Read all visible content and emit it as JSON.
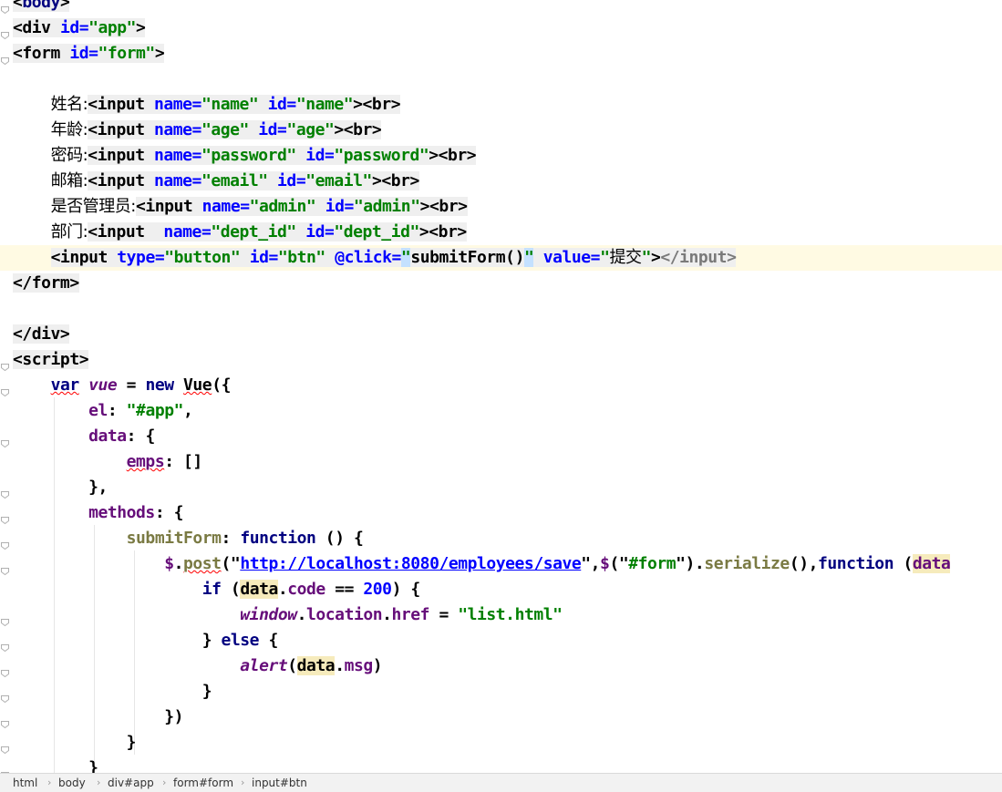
{
  "editor": {
    "lines": [
      {
        "segs": [
          [
            "<",
            "tag"
          ],
          [
            "body",
            "tag tn"
          ],
          [
            ">",
            "tag"
          ]
        ]
      },
      {
        "segs": [
          [
            "<div ",
            "tag"
          ],
          [
            "id=",
            "tag an"
          ],
          [
            "\"app\"",
            "tag av"
          ],
          [
            ">",
            "tag"
          ]
        ]
      },
      {
        "segs": [
          [
            "<form ",
            "tag"
          ],
          [
            "id=",
            "tag an"
          ],
          [
            "\"form\"",
            "tag av"
          ],
          [
            ">",
            "tag"
          ]
        ]
      },
      {
        "segs": []
      },
      {
        "segs": [
          [
            "    ",
            ""
          ],
          [
            "姓名:",
            "cjk"
          ],
          [
            "<input ",
            "tag"
          ],
          [
            "name=",
            "tag an"
          ],
          [
            "\"name\" ",
            "tag av"
          ],
          [
            "id=",
            "tag an"
          ],
          [
            "\"name\"",
            "tag av"
          ],
          [
            "><br>",
            "tag"
          ]
        ]
      },
      {
        "segs": [
          [
            "    ",
            ""
          ],
          [
            "年龄:",
            "cjk"
          ],
          [
            "<input ",
            "tag"
          ],
          [
            "name=",
            "tag an"
          ],
          [
            "\"age\" ",
            "tag av"
          ],
          [
            "id=",
            "tag an"
          ],
          [
            "\"age\"",
            "tag av"
          ],
          [
            "><br>",
            "tag"
          ]
        ]
      },
      {
        "segs": [
          [
            "    ",
            ""
          ],
          [
            "密码:",
            "cjk"
          ],
          [
            "<input ",
            "tag"
          ],
          [
            "name=",
            "tag an"
          ],
          [
            "\"password\" ",
            "tag av"
          ],
          [
            "id=",
            "tag an"
          ],
          [
            "\"password\"",
            "tag av"
          ],
          [
            "><br>",
            "tag"
          ]
        ]
      },
      {
        "segs": [
          [
            "    ",
            ""
          ],
          [
            "邮箱:",
            "cjk"
          ],
          [
            "<input ",
            "tag"
          ],
          [
            "name=",
            "tag an"
          ],
          [
            "\"email\" ",
            "tag av"
          ],
          [
            "id=",
            "tag an"
          ],
          [
            "\"email\"",
            "tag av"
          ],
          [
            "><br>",
            "tag"
          ]
        ]
      },
      {
        "segs": [
          [
            "    ",
            ""
          ],
          [
            "是否管理员:",
            "cjk"
          ],
          [
            "<input ",
            "tag"
          ],
          [
            "name=",
            "tag an"
          ],
          [
            "\"admin\" ",
            "tag av"
          ],
          [
            "id=",
            "tag an"
          ],
          [
            "\"admin\"",
            "tag av"
          ],
          [
            "><br>",
            "tag"
          ]
        ]
      },
      {
        "segs": [
          [
            "    ",
            ""
          ],
          [
            "部门:",
            "cjk"
          ],
          [
            "<input  ",
            "tag"
          ],
          [
            "name=",
            "tag an"
          ],
          [
            "\"dept_id\" ",
            "tag av"
          ],
          [
            "id=",
            "tag an"
          ],
          [
            "\"dept_id\"",
            "tag av"
          ],
          [
            "><br>",
            "tag"
          ]
        ]
      },
      {
        "cur": true,
        "segs": [
          [
            "    ",
            ""
          ],
          [
            "<input ",
            "tag"
          ],
          [
            "type=",
            "tag an"
          ],
          [
            "\"button\" ",
            "tag av"
          ],
          [
            "id=",
            "tag an"
          ],
          [
            "\"btn\" ",
            "tag av"
          ],
          [
            "@click=",
            "tag an"
          ],
          [
            "\"",
            "tag av sel"
          ],
          [
            "submitForm()",
            "tag"
          ],
          [
            "\"",
            "tag av sel"
          ],
          [
            " value=",
            "tag an"
          ],
          [
            "\"",
            "tag av"
          ],
          [
            "提交",
            "tag cjk"
          ],
          [
            "\"",
            "tag av"
          ],
          [
            ">",
            "tag"
          ],
          [
            "</input>",
            "tag closeh"
          ]
        ]
      },
      {
        "segs": [
          [
            "</form>",
            "tag"
          ]
        ]
      },
      {
        "segs": []
      },
      {
        "segs": [
          [
            "</div>",
            "tag"
          ]
        ]
      },
      {
        "segs": [
          [
            "<script>",
            "tag"
          ]
        ]
      },
      {
        "segs": [
          [
            "    ",
            ""
          ],
          [
            "var",
            "kw squig"
          ],
          [
            " ",
            ""
          ],
          [
            "vue",
            "var"
          ],
          [
            " = ",
            ""
          ],
          [
            "new ",
            "kw"
          ],
          [
            "Vue",
            "squig"
          ],
          [
            "({",
            ""
          ]
        ]
      },
      {
        "segs": [
          [
            "        ",
            ""
          ],
          [
            "el",
            "prop"
          ],
          [
            ": ",
            ""
          ],
          [
            "\"#app\"",
            "str"
          ],
          [
            ",",
            ""
          ]
        ]
      },
      {
        "segs": [
          [
            "        ",
            ""
          ],
          [
            "data",
            "prop"
          ],
          [
            ": {",
            ""
          ]
        ]
      },
      {
        "segs": [
          [
            "            ",
            ""
          ],
          [
            "emps",
            "prop squig"
          ],
          [
            ": []",
            ""
          ]
        ]
      },
      {
        "segs": [
          [
            "        },",
            ""
          ]
        ]
      },
      {
        "segs": [
          [
            "        ",
            ""
          ],
          [
            "methods",
            "prop"
          ],
          [
            ": {",
            ""
          ]
        ]
      },
      {
        "segs": [
          [
            "            ",
            ""
          ],
          [
            "submitForm",
            "mc"
          ],
          [
            ": ",
            ""
          ],
          [
            "function",
            "kw"
          ],
          [
            " () {",
            ""
          ]
        ]
      },
      {
        "segs": [
          [
            "                ",
            ""
          ],
          [
            "$",
            "prop"
          ],
          [
            ".",
            ""
          ],
          [
            "post",
            "mc squig"
          ],
          [
            "(\"",
            ""
          ],
          [
            "http://localhost:8080/employees/save",
            "url"
          ],
          [
            "\",",
            ""
          ],
          [
            "$",
            "prop"
          ],
          [
            "(\"",
            ""
          ],
          [
            "#form",
            "str"
          ],
          [
            "\").",
            ""
          ],
          [
            "serialize",
            "mc"
          ],
          [
            "(),",
            ""
          ],
          [
            "function",
            "kw"
          ],
          [
            " (",
            ""
          ],
          [
            "data",
            "prop hl"
          ]
        ]
      },
      {
        "segs": [
          [
            "                    ",
            ""
          ],
          [
            "if",
            "kw"
          ],
          [
            " (",
            ""
          ],
          [
            "data",
            "hl"
          ],
          [
            ".",
            ""
          ],
          [
            "code",
            "prop"
          ],
          [
            " == ",
            ""
          ],
          [
            "200",
            "num"
          ],
          [
            ") {",
            ""
          ]
        ]
      },
      {
        "segs": [
          [
            "                        ",
            ""
          ],
          [
            "window",
            "var"
          ],
          [
            ".",
            ""
          ],
          [
            "location",
            "prop"
          ],
          [
            ".",
            ""
          ],
          [
            "href",
            "prop"
          ],
          [
            " = ",
            ""
          ],
          [
            "\"list.html\"",
            "str"
          ]
        ]
      },
      {
        "segs": [
          [
            "                    } ",
            ""
          ],
          [
            "else",
            "kw"
          ],
          [
            " {",
            ""
          ]
        ]
      },
      {
        "segs": [
          [
            "                        ",
            ""
          ],
          [
            "alert",
            "var"
          ],
          [
            "(",
            ""
          ],
          [
            "data",
            "hl"
          ],
          [
            ".",
            ""
          ],
          [
            "msg",
            "prop"
          ],
          [
            ")",
            ""
          ]
        ]
      },
      {
        "segs": [
          [
            "                    }",
            ""
          ]
        ]
      },
      {
        "segs": [
          [
            "                })",
            ""
          ]
        ]
      },
      {
        "segs": [
          [
            "            }",
            ""
          ]
        ]
      },
      {
        "segs": [
          [
            "        }",
            ""
          ]
        ]
      }
    ]
  },
  "breadcrumb": [
    "html",
    "body",
    "div#app",
    "form#form",
    "input#btn"
  ],
  "colors": {
    "current_line": "#fffae3",
    "tag_bg": "#efefef",
    "keyword": "#000080",
    "attr_value": "#008000",
    "string": "#008000",
    "property": "#660e7a",
    "number": "#0000ff"
  }
}
